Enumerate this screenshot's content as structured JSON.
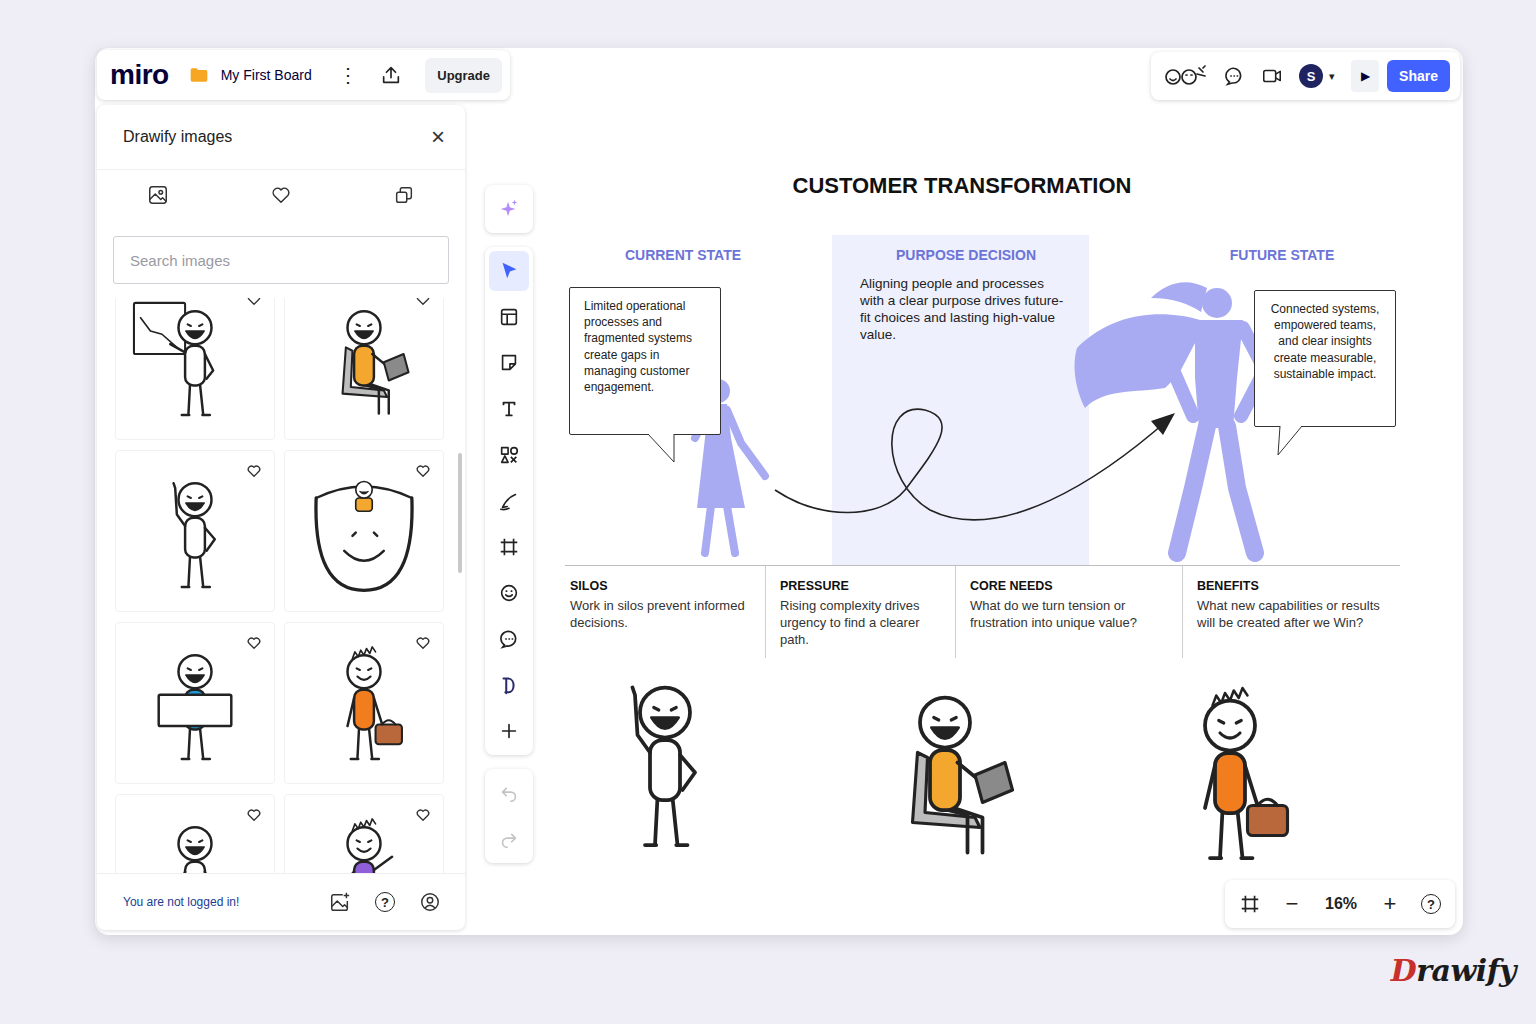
{
  "app": {
    "logo": "miro",
    "board_name": "My First Board",
    "more": "⋮",
    "upgrade": "Upgrade",
    "avatar": "S",
    "avatar_caret": "▾",
    "play": "▶",
    "share": "Share"
  },
  "panel": {
    "title": "Drawify images",
    "close": "×",
    "search": {
      "placeholder": "Search images"
    },
    "images": [
      {
        "kind": "presenter",
        "color": "#ffffff"
      },
      {
        "kind": "laptop",
        "color": "#f3a72f"
      },
      {
        "kind": "pointing",
        "color": "#ffffff"
      },
      {
        "kind": "hat",
        "color": "#f3a72f"
      },
      {
        "kind": "sign",
        "color": "#1e9bd7"
      },
      {
        "kind": "briefcase",
        "color": "#f27d1f"
      },
      {
        "kind": "sitting",
        "color": "#ffffff"
      },
      {
        "kind": "waving",
        "color": "#8e5fd9"
      }
    ],
    "footer": "You are not logged in!",
    "footer_help": "?"
  },
  "tools": [
    {
      "kind": "sparkle",
      "selected": false
    },
    {
      "kind": "select",
      "selected": true
    },
    {
      "kind": "templates",
      "selected": false
    },
    {
      "kind": "sticky",
      "selected": false
    },
    {
      "kind": "text",
      "selected": false
    },
    {
      "kind": "shapes",
      "selected": false
    },
    {
      "kind": "pen",
      "selected": false
    },
    {
      "kind": "frame",
      "selected": false
    },
    {
      "kind": "emoji",
      "selected": false
    },
    {
      "kind": "comment",
      "selected": false
    },
    {
      "kind": "drawify",
      "selected": false
    },
    {
      "kind": "add",
      "selected": false
    }
  ],
  "history": [
    {
      "kind": "undo",
      "disabled": true
    },
    {
      "kind": "redo",
      "disabled": true
    }
  ],
  "board": {
    "title": "CUSTOMER TRANSFORMATION",
    "stages": [
      {
        "heading": "CURRENT STATE",
        "text": "Limited operational processes and fragmented systems create gaps in managing customer engagement."
      },
      {
        "heading": "PURPOSE DECISION",
        "text": "Aligning people and processes with a clear purpose drives future-fit choices and lasting high-value value."
      },
      {
        "heading": "FUTURE STATE",
        "text": "Connected systems, empowered teams, and clear insights create measurable, sustainable impact."
      }
    ],
    "factors": [
      {
        "heading": "SILOS",
        "text": "Work in silos prevent informed decisions."
      },
      {
        "heading": "PRESSURE",
        "text": "Rising complexity drives urgency to find a clearer path."
      },
      {
        "heading": "CORE NEEDS",
        "text": "What do we turn tension or frustration into unique value?"
      },
      {
        "heading": "BENEFITS",
        "text": "What new capabilities or results will be created after we Win?"
      }
    ],
    "figures": [
      {
        "kind": "pointing",
        "color": "#ffffff"
      },
      {
        "kind": "laptop",
        "color": "#f3a72f"
      },
      {
        "kind": "briefcase",
        "color": "#f27d1f"
      }
    ]
  },
  "zoom": {
    "minus": "−",
    "level": "16%",
    "plus": "+",
    "help": "?"
  },
  "brand": "Drawify"
}
